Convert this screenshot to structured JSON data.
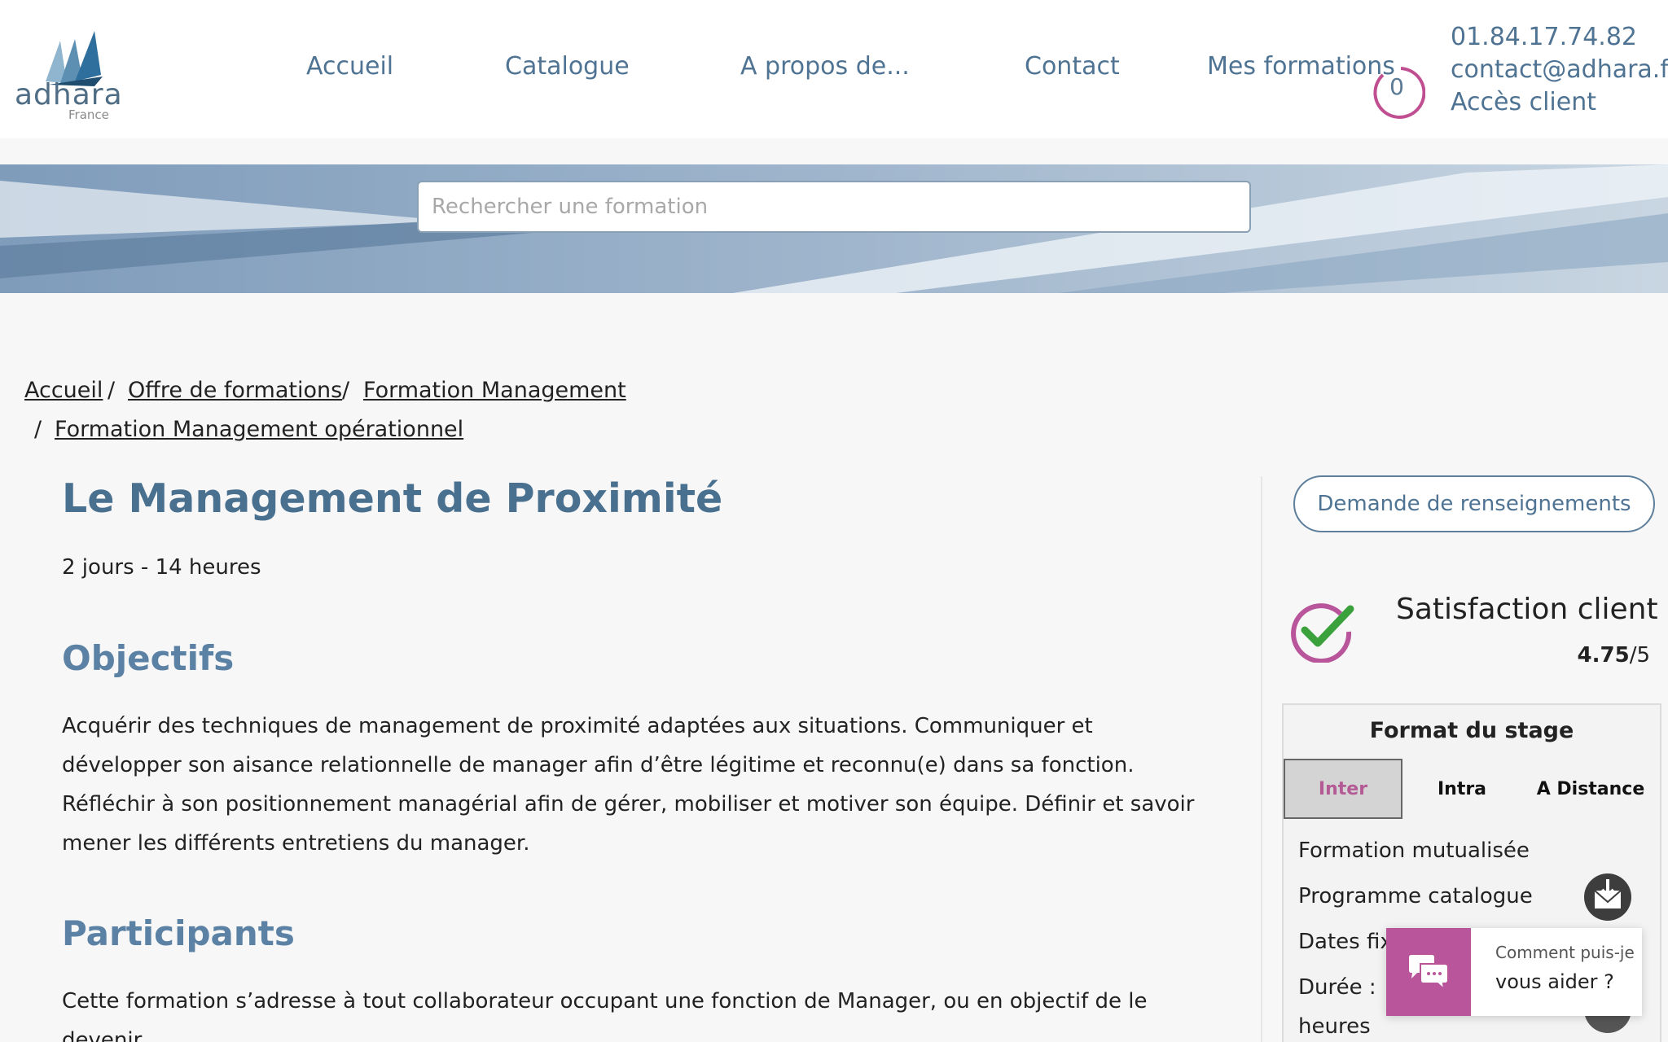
{
  "header": {
    "logo_text": "adhara",
    "logo_sub": "France",
    "nav": [
      "Accueil",
      "Catalogue",
      "A propos de...",
      "Contact",
      "Mes formations"
    ],
    "cart_count": "0",
    "phone": "01.84.17.74.82",
    "email": "contact@adhara.fr",
    "client_access": "Accès client"
  },
  "search": {
    "placeholder": "Rechercher une formation"
  },
  "breadcrumb": [
    "Accueil",
    "Offre de formations",
    "Formation Management",
    "Formation Management opérationnel"
  ],
  "course": {
    "title": "Le Management de Proximité",
    "duration": "2 jours - 14 heures",
    "objectives_title": "Objectifs",
    "objectives_text": "Acquérir des techniques de management de proximité adaptées aux situations. Communiquer et développer son aisance relationnelle de manager afin d’être légitime et reconnu(e) dans sa fonction. Réfléchir à son positionnement managérial afin de gérer, mobiliser et motiver son équipe. Définir et savoir mener les différents entretiens du manager.",
    "participants_title": "Participants",
    "participants_text": "Cette formation s’adresse à tout collaborateur occupant une fonction de Manager, ou en objectif de le devenir."
  },
  "sidebar": {
    "info_button": "Demande de renseignements",
    "satisfaction_label": "Satisfaction client",
    "satisfaction_score": "4.75",
    "satisfaction_max": "/5",
    "format_title": "Format du stage",
    "tabs": [
      "Inter",
      "Intra",
      "A Distance"
    ],
    "lines": [
      "Formation mutualisée",
      "Programme catalogue",
      "Dates fix",
      "Durée :",
      "heures"
    ]
  },
  "chat": {
    "line1": "Comment puis-je",
    "line2": "vous aider ?"
  },
  "colors": {
    "brand_blue": "#4f7393",
    "accent_pink": "#b9559a"
  }
}
